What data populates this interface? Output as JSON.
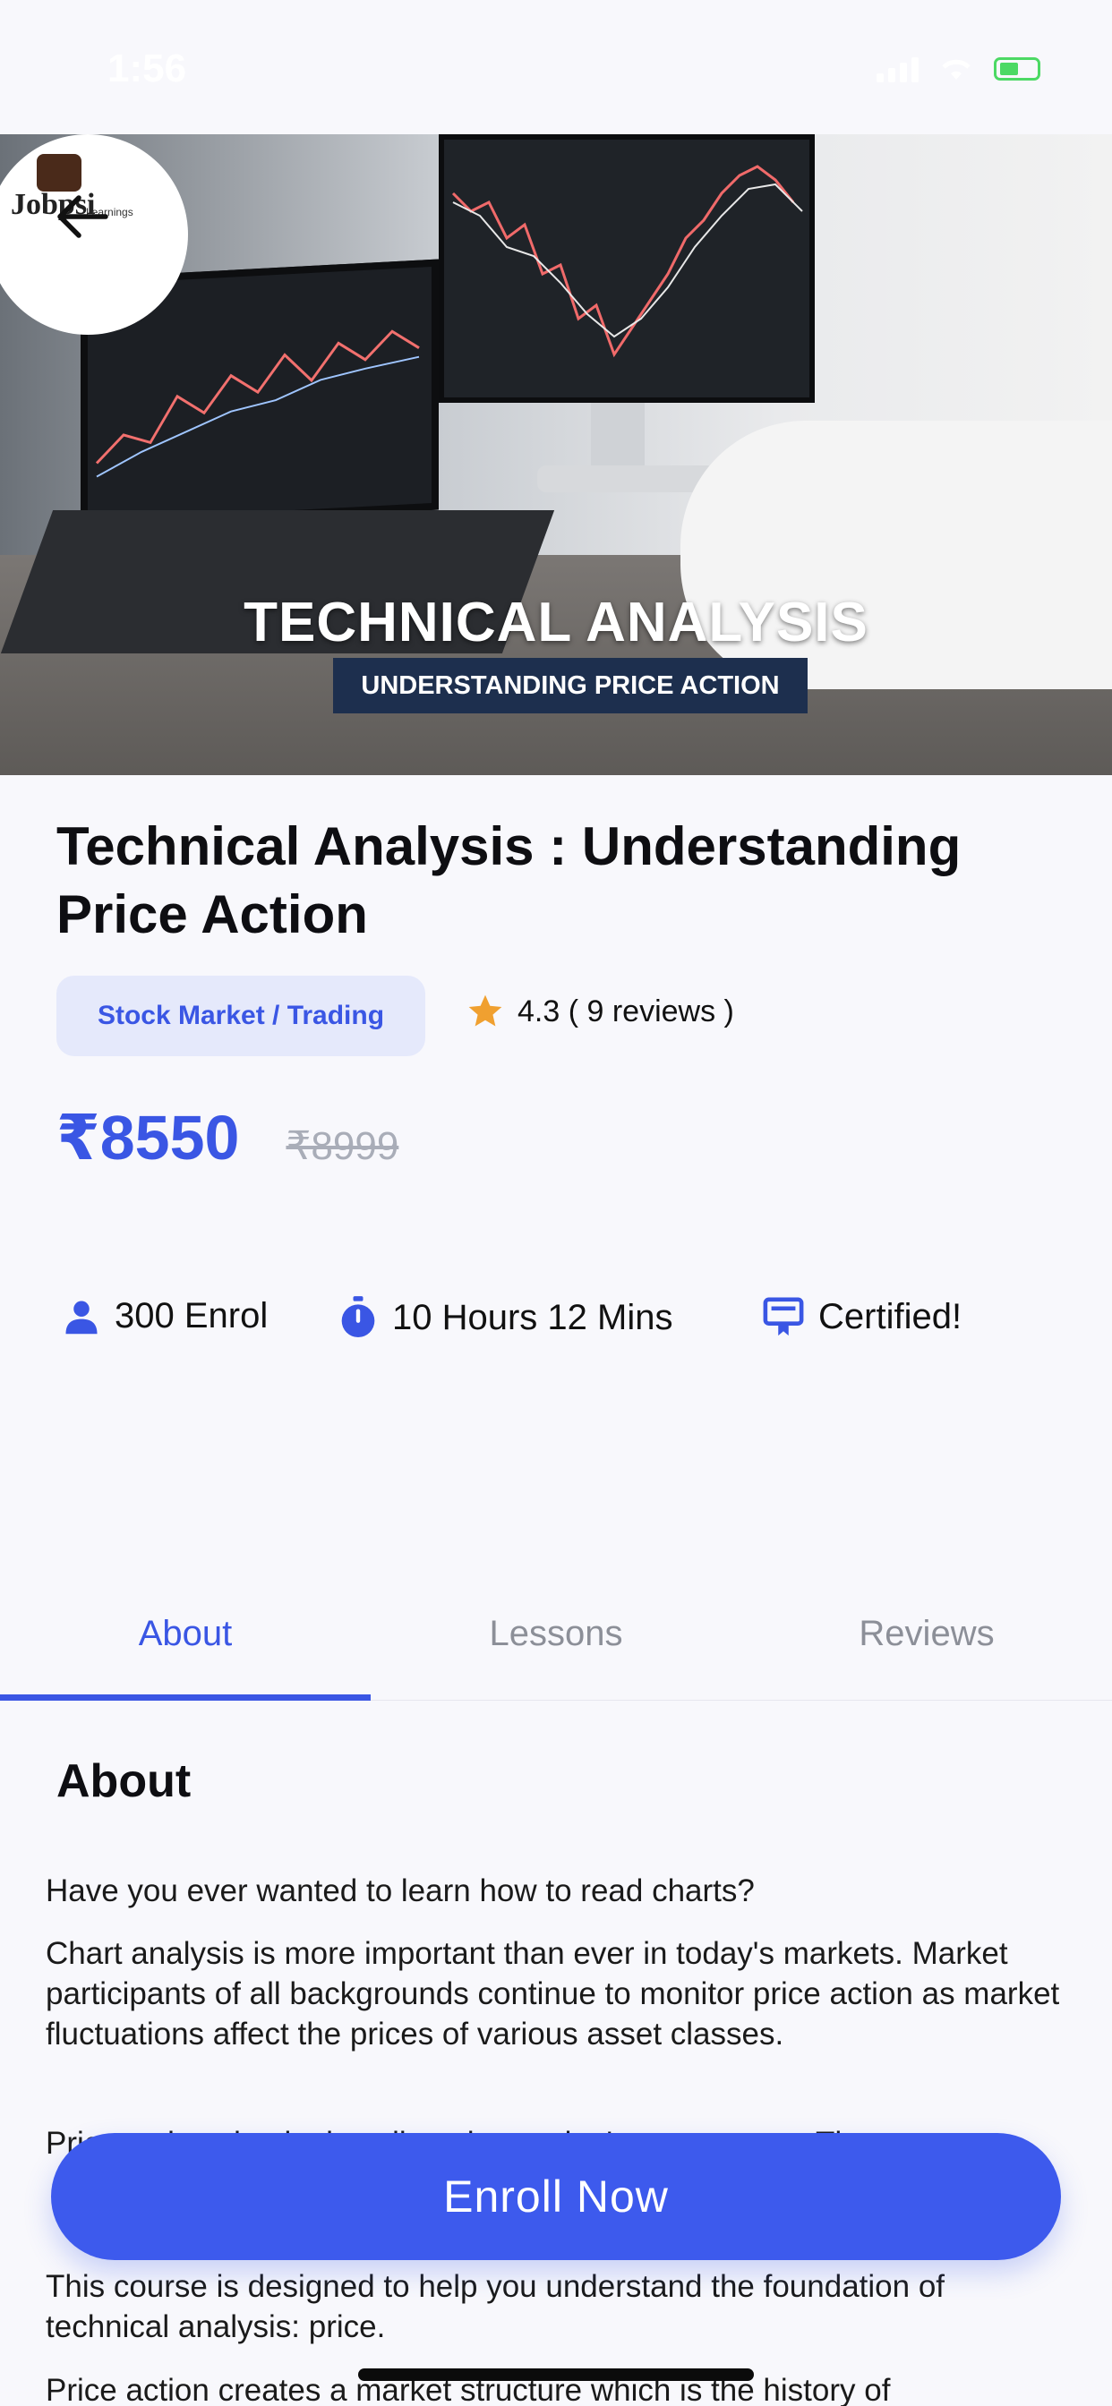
{
  "status_bar": {
    "time": "1:56"
  },
  "hero": {
    "title": "TECHNICAL ANALYSIS",
    "subtitle": "UNDERSTANDING PRICE ACTION",
    "logo_text": "Jobpsi",
    "logo_sub": "Learnings"
  },
  "course": {
    "title": "Technical Analysis : Understanding Price Action",
    "category": "Stock Market / Trading",
    "rating": "4.3 ( 9 reviews )",
    "price": "₹8550",
    "original_price": "₹8999"
  },
  "meta": {
    "enrolled": "300 Enrol",
    "duration": "10 Hours 12 Mins",
    "certificate": "Certified!"
  },
  "tabs": [
    {
      "label": "About"
    },
    {
      "label": "Lessons"
    },
    {
      "label": "Reviews"
    }
  ],
  "about": {
    "heading": "About",
    "paragraphs": [
      "Have you ever wanted to learn how to read charts?",
      "Chart analysis is more important than ever in today's markets. Market participants of all backgrounds continue to monitor price action as market fluctuations affect the prices of various asset classes.",
      "Price action simply describes the market's movements. The",
      "This course is designed to help you understand the foundation of technical analysis: price.",
      "Price action creates a market structure which is the history of"
    ]
  },
  "actions": {
    "enroll_label": "Enroll Now"
  },
  "colors": {
    "accent": "#3d5aed",
    "chip_bg": "#e5e9fb",
    "star": "#f0a030"
  }
}
